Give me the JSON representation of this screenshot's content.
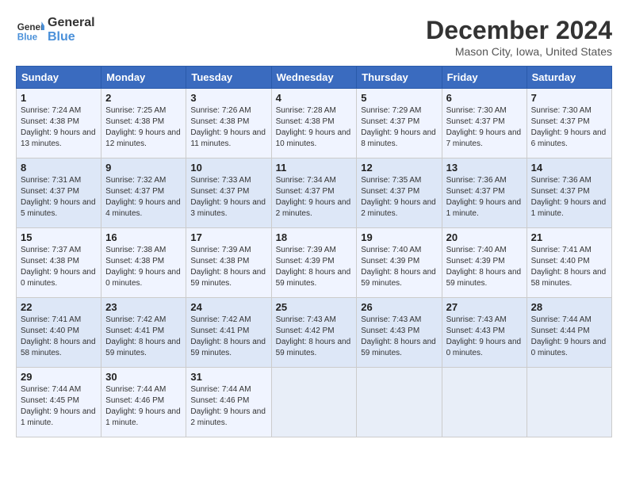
{
  "header": {
    "logo_line1": "General",
    "logo_line2": "Blue",
    "month": "December 2024",
    "location": "Mason City, Iowa, United States"
  },
  "columns": [
    "Sunday",
    "Monday",
    "Tuesday",
    "Wednesday",
    "Thursday",
    "Friday",
    "Saturday"
  ],
  "weeks": [
    [
      {
        "day": "1",
        "sunrise": "7:24 AM",
        "sunset": "4:38 PM",
        "daylight": "9 hours and 13 minutes."
      },
      {
        "day": "2",
        "sunrise": "7:25 AM",
        "sunset": "4:38 PM",
        "daylight": "9 hours and 12 minutes."
      },
      {
        "day": "3",
        "sunrise": "7:26 AM",
        "sunset": "4:38 PM",
        "daylight": "9 hours and 11 minutes."
      },
      {
        "day": "4",
        "sunrise": "7:28 AM",
        "sunset": "4:38 PM",
        "daylight": "9 hours and 10 minutes."
      },
      {
        "day": "5",
        "sunrise": "7:29 AM",
        "sunset": "4:37 PM",
        "daylight": "9 hours and 8 minutes."
      },
      {
        "day": "6",
        "sunrise": "7:30 AM",
        "sunset": "4:37 PM",
        "daylight": "9 hours and 7 minutes."
      },
      {
        "day": "7",
        "sunrise": "7:30 AM",
        "sunset": "4:37 PM",
        "daylight": "9 hours and 6 minutes."
      }
    ],
    [
      {
        "day": "8",
        "sunrise": "7:31 AM",
        "sunset": "4:37 PM",
        "daylight": "9 hours and 5 minutes."
      },
      {
        "day": "9",
        "sunrise": "7:32 AM",
        "sunset": "4:37 PM",
        "daylight": "9 hours and 4 minutes."
      },
      {
        "day": "10",
        "sunrise": "7:33 AM",
        "sunset": "4:37 PM",
        "daylight": "9 hours and 3 minutes."
      },
      {
        "day": "11",
        "sunrise": "7:34 AM",
        "sunset": "4:37 PM",
        "daylight": "9 hours and 2 minutes."
      },
      {
        "day": "12",
        "sunrise": "7:35 AM",
        "sunset": "4:37 PM",
        "daylight": "9 hours and 2 minutes."
      },
      {
        "day": "13",
        "sunrise": "7:36 AM",
        "sunset": "4:37 PM",
        "daylight": "9 hours and 1 minute."
      },
      {
        "day": "14",
        "sunrise": "7:36 AM",
        "sunset": "4:37 PM",
        "daylight": "9 hours and 1 minute."
      }
    ],
    [
      {
        "day": "15",
        "sunrise": "7:37 AM",
        "sunset": "4:38 PM",
        "daylight": "9 hours and 0 minutes."
      },
      {
        "day": "16",
        "sunrise": "7:38 AM",
        "sunset": "4:38 PM",
        "daylight": "9 hours and 0 minutes."
      },
      {
        "day": "17",
        "sunrise": "7:39 AM",
        "sunset": "4:38 PM",
        "daylight": "8 hours and 59 minutes."
      },
      {
        "day": "18",
        "sunrise": "7:39 AM",
        "sunset": "4:39 PM",
        "daylight": "8 hours and 59 minutes."
      },
      {
        "day": "19",
        "sunrise": "7:40 AM",
        "sunset": "4:39 PM",
        "daylight": "8 hours and 59 minutes."
      },
      {
        "day": "20",
        "sunrise": "7:40 AM",
        "sunset": "4:39 PM",
        "daylight": "8 hours and 59 minutes."
      },
      {
        "day": "21",
        "sunrise": "7:41 AM",
        "sunset": "4:40 PM",
        "daylight": "8 hours and 58 minutes."
      }
    ],
    [
      {
        "day": "22",
        "sunrise": "7:41 AM",
        "sunset": "4:40 PM",
        "daylight": "8 hours and 58 minutes."
      },
      {
        "day": "23",
        "sunrise": "7:42 AM",
        "sunset": "4:41 PM",
        "daylight": "8 hours and 59 minutes."
      },
      {
        "day": "24",
        "sunrise": "7:42 AM",
        "sunset": "4:41 PM",
        "daylight": "8 hours and 59 minutes."
      },
      {
        "day": "25",
        "sunrise": "7:43 AM",
        "sunset": "4:42 PM",
        "daylight": "8 hours and 59 minutes."
      },
      {
        "day": "26",
        "sunrise": "7:43 AM",
        "sunset": "4:43 PM",
        "daylight": "8 hours and 59 minutes."
      },
      {
        "day": "27",
        "sunrise": "7:43 AM",
        "sunset": "4:43 PM",
        "daylight": "9 hours and 0 minutes."
      },
      {
        "day": "28",
        "sunrise": "7:44 AM",
        "sunset": "4:44 PM",
        "daylight": "9 hours and 0 minutes."
      }
    ],
    [
      {
        "day": "29",
        "sunrise": "7:44 AM",
        "sunset": "4:45 PM",
        "daylight": "9 hours and 1 minute."
      },
      {
        "day": "30",
        "sunrise": "7:44 AM",
        "sunset": "4:46 PM",
        "daylight": "9 hours and 1 minute."
      },
      {
        "day": "31",
        "sunrise": "7:44 AM",
        "sunset": "4:46 PM",
        "daylight": "9 hours and 2 minutes."
      },
      null,
      null,
      null,
      null
    ]
  ]
}
